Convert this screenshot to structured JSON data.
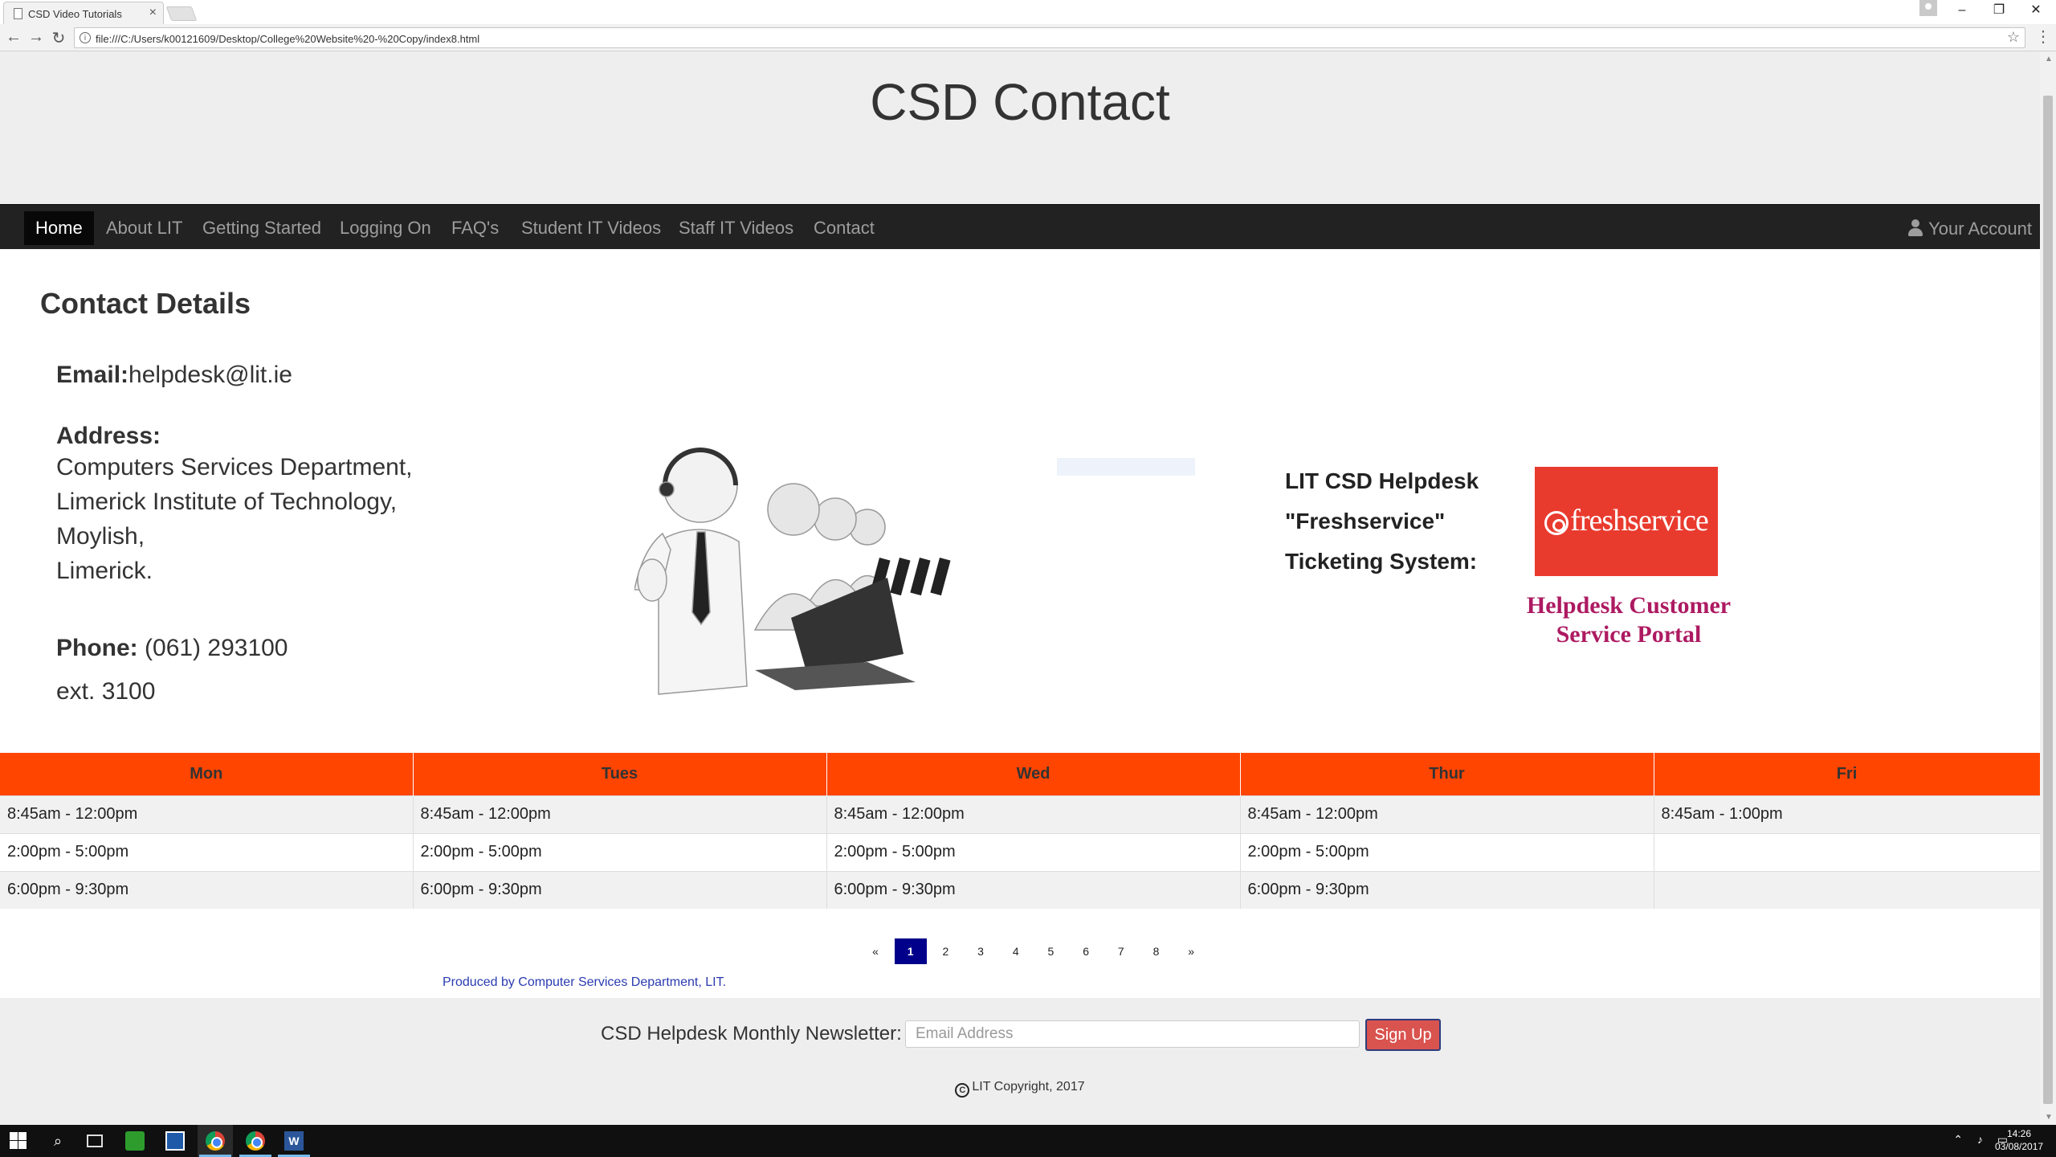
{
  "browser": {
    "tab_title": "CSD Video Tutorials",
    "url": "file:///C:/Users/k00121609/Desktop/College%20Website%20-%20Copy/index8.html"
  },
  "page": {
    "title": "CSD Contact"
  },
  "nav": {
    "items": [
      {
        "label": "Home",
        "active": true
      },
      {
        "label": "About LIT"
      },
      {
        "label": "Getting Started"
      },
      {
        "label": "Logging On"
      },
      {
        "label": "FAQ's"
      },
      {
        "label": "Student IT Videos"
      },
      {
        "label": "Staff IT Videos"
      },
      {
        "label": "Contact"
      }
    ],
    "account_label": "Your Account"
  },
  "contact": {
    "heading": "Contact Details",
    "email_label": "Email:",
    "email_value": "helpdesk@lit.ie",
    "address_label": "Address:",
    "address_lines": [
      "Computers Services Department,",
      "Limerick Institute of Technology,",
      "Moylish,",
      "Limerick."
    ],
    "phone_label": "Phone:",
    "phone_value": "(061) 293100",
    "phone_ext": "ext. 3100"
  },
  "helpdesk": {
    "lines": [
      "LIT CSD Helpdesk",
      "\"Freshservice\"",
      "Ticketing System:"
    ],
    "logo_text": "freshservice",
    "portal_line1": "Helpdesk Customer",
    "portal_line2": "Service Portal"
  },
  "colors": {
    "table_header": "#ff4500",
    "freshservice_red": "#e93a2e",
    "portal_text": "#ad1a61",
    "pagination_active": "#00008b",
    "signup_button": "#d9534f"
  },
  "hours": {
    "headers": [
      "Mon",
      "Tues",
      "Wed",
      "Thur",
      "Fri"
    ],
    "rows": [
      [
        "8:45am - 12:00pm",
        "8:45am - 12:00pm",
        "8:45am - 12:00pm",
        "8:45am - 12:00pm",
        "8:45am - 1:00pm"
      ],
      [
        "2:00pm - 5:00pm",
        "2:00pm - 5:00pm",
        "2:00pm - 5:00pm",
        "2:00pm - 5:00pm",
        ""
      ],
      [
        "6:00pm - 9:30pm",
        "6:00pm - 9:30pm",
        "6:00pm - 9:30pm",
        "6:00pm - 9:30pm",
        ""
      ]
    ]
  },
  "pagination": {
    "prev": "«",
    "pages": [
      "1",
      "2",
      "3",
      "4",
      "5",
      "6",
      "7",
      "8"
    ],
    "active_page": "1",
    "next": "»"
  },
  "credit": "Produced by Computer Services Department, LIT.",
  "footer": {
    "newsletter_label": "CSD Helpdesk Monthly Newsletter:",
    "email_placeholder": "Email Address",
    "signup_label": "Sign Up",
    "copyright_symbol": "C",
    "copyright": "LIT Copyright, 2017"
  },
  "taskbar": {
    "time": "14:26",
    "date": "03/08/2017"
  },
  "icons": [
    "windows-start-icon",
    "search-icon",
    "task-view-icon",
    "chrome-icon",
    "word-icon",
    "user-icon",
    "star-icon",
    "back-arrow-icon",
    "forward-arrow-icon",
    "reload-icon"
  ]
}
